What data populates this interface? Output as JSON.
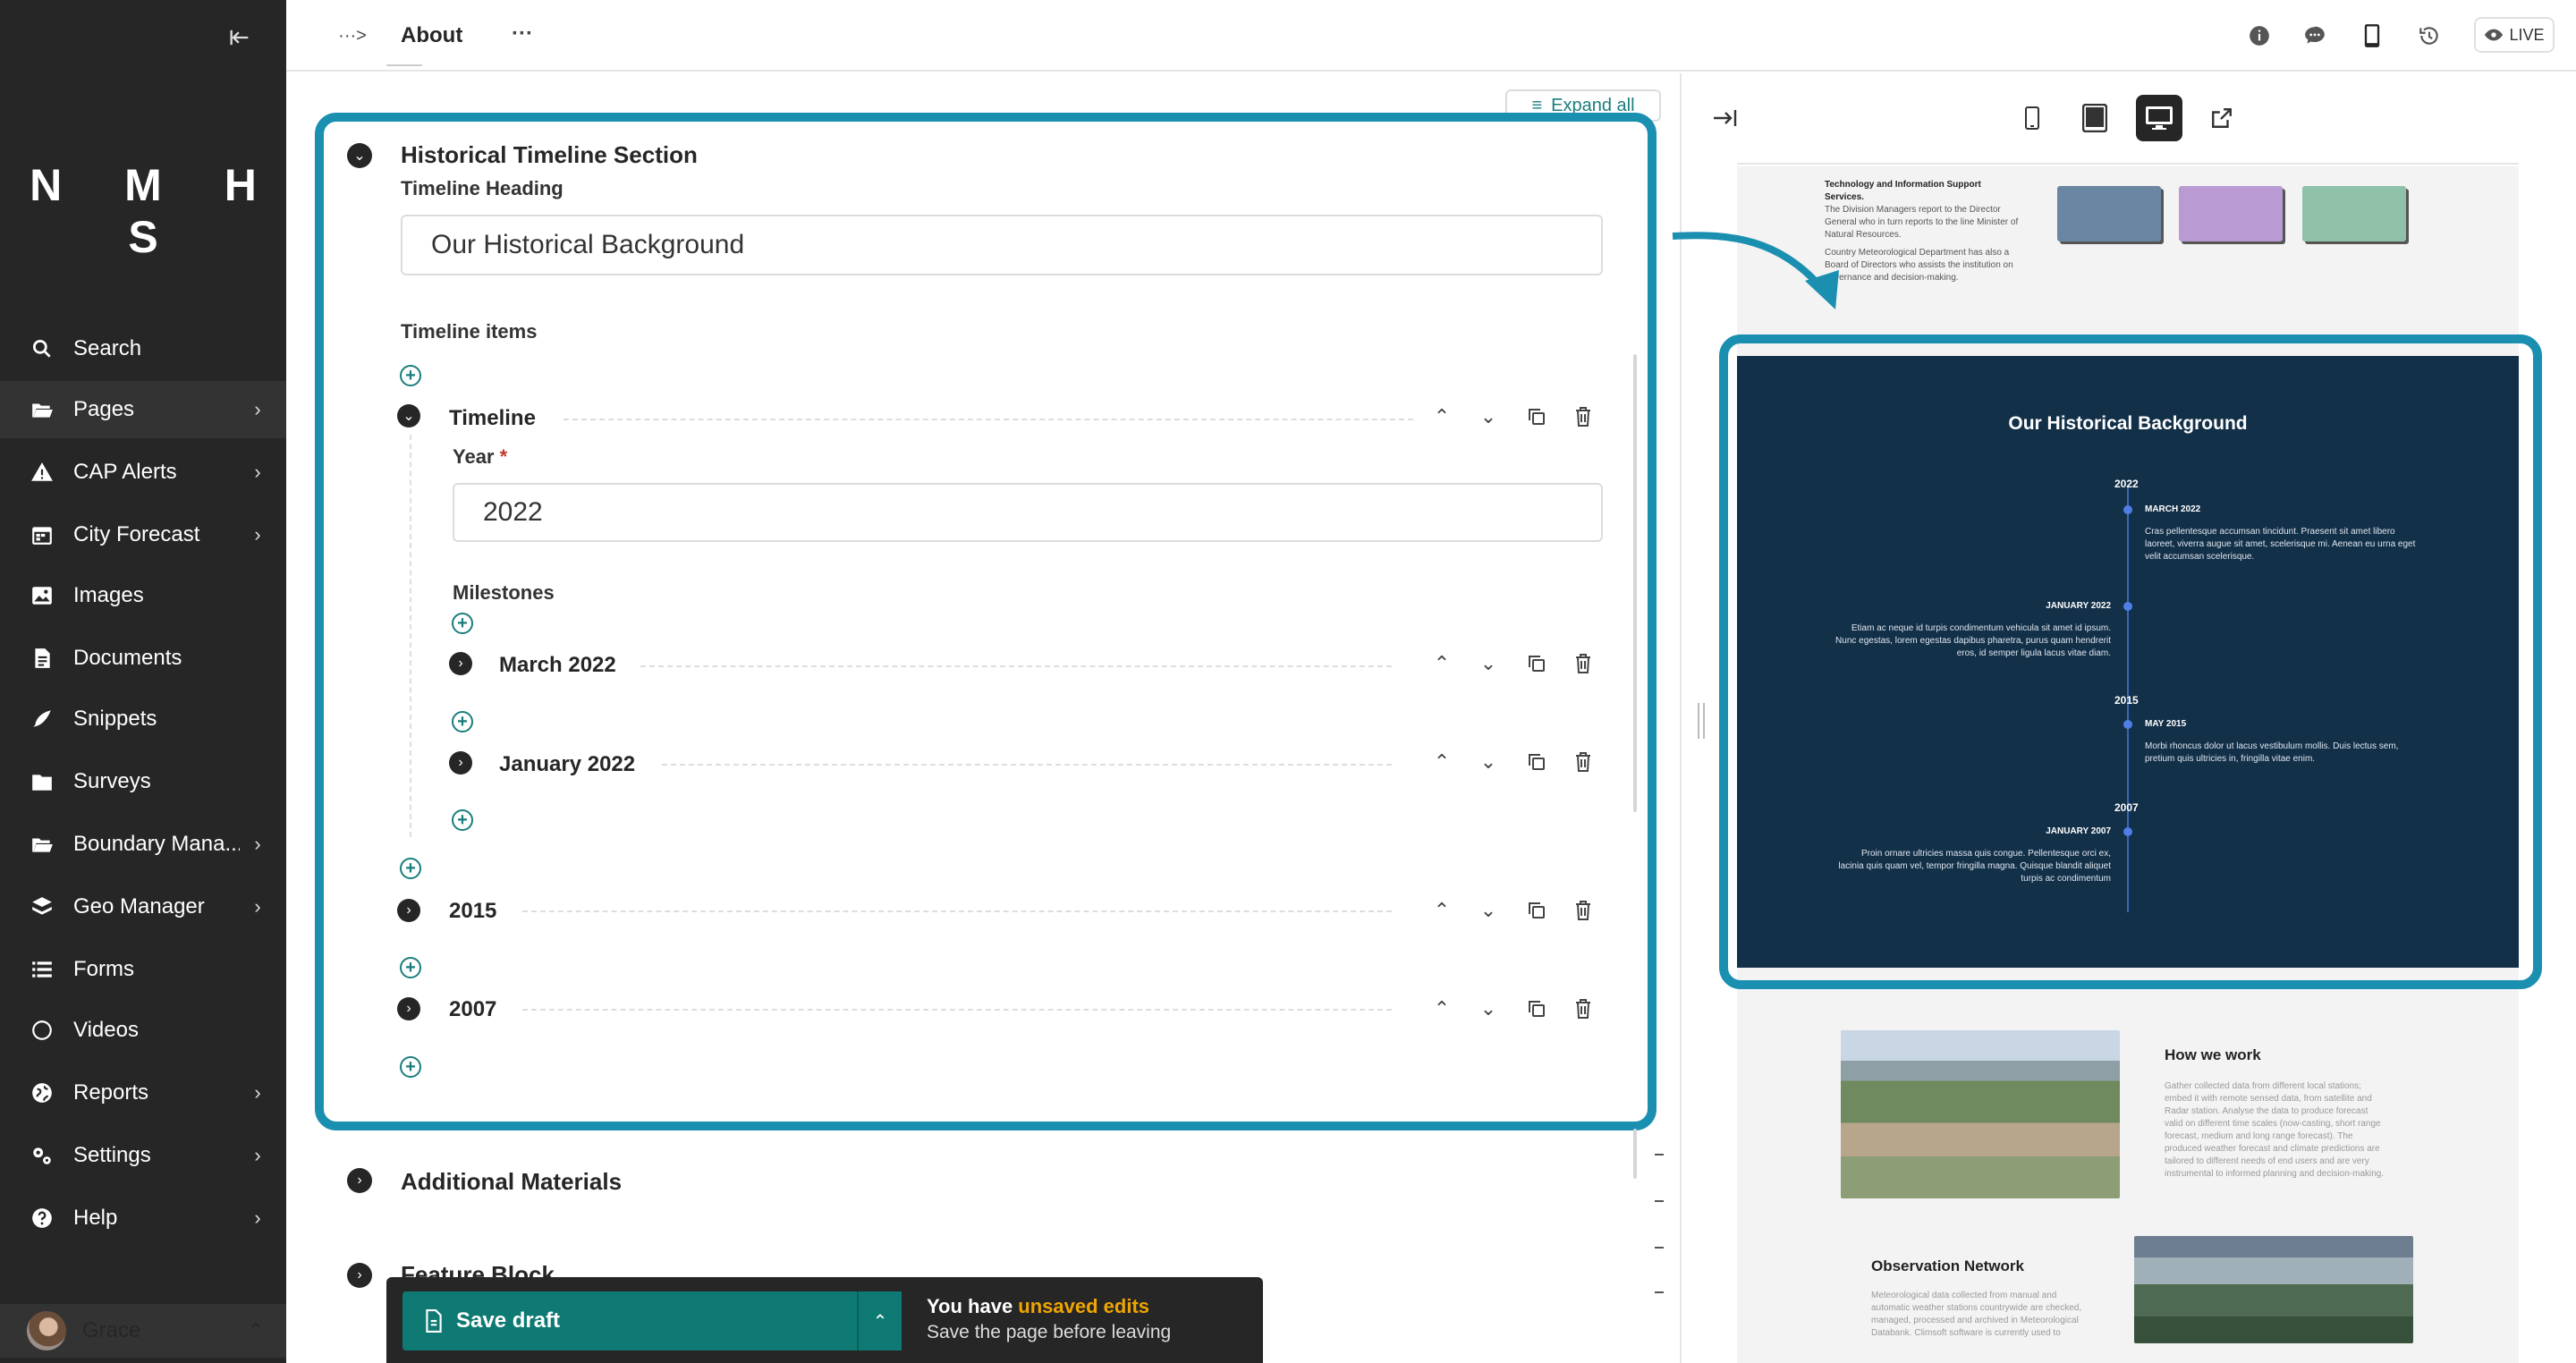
{
  "sidebar": {
    "logo": "N M H S",
    "items": [
      {
        "label": "Search",
        "chevron": false
      },
      {
        "label": "Pages",
        "chevron": true
      },
      {
        "label": "CAP Alerts",
        "chevron": true
      },
      {
        "label": "City Forecast",
        "chevron": true
      },
      {
        "label": "Images",
        "chevron": false
      },
      {
        "label": "Documents",
        "chevron": false
      },
      {
        "label": "Snippets",
        "chevron": false
      },
      {
        "label": "Surveys",
        "chevron": false
      },
      {
        "label": "Boundary Mana...",
        "chevron": true
      },
      {
        "label": "Geo Manager",
        "chevron": true
      },
      {
        "label": "Forms",
        "chevron": false
      },
      {
        "label": "Videos",
        "chevron": false
      },
      {
        "label": "Reports",
        "chevron": true
      },
      {
        "label": "Settings",
        "chevron": true
      },
      {
        "label": "Help",
        "chevron": true
      }
    ],
    "user": "Grace"
  },
  "header": {
    "breadcrumb_sep": "···>",
    "title": "About",
    "more": "···",
    "live": "LIVE"
  },
  "editor": {
    "expand_all": "Expand all",
    "section_title": "Historical Timeline Section",
    "timeline_heading_label": "Timeline Heading",
    "timeline_heading_value": "Our Historical Background",
    "timeline_items_label": "Timeline items",
    "timeline_block_label": "Timeline",
    "year_label": "Year",
    "year_required": "*",
    "year_value": "2022",
    "milestones_label": "Milestones",
    "milestones": [
      "March 2022",
      "January 2022"
    ],
    "other_timelines": [
      "2015",
      "2007"
    ],
    "additional_materials": "Additional Materials",
    "feature_block": "Feature Block"
  },
  "footer": {
    "save_draft": "Save draft",
    "notice_prefix": "You have ",
    "notice_highlight": "unsaved edits",
    "notice_sub": "Save the page before leaving"
  },
  "preview": {
    "top_heading": "Technology and Information Support Services.",
    "top_text_1": "The Division Managers report to the Director General who in turn reports to the line Minister of Natural Resources.",
    "top_text_2": "Country Meteorological Department has also a Board of Directors who assists the institution on governance and decision-making.",
    "timeline_title": "Our Historical Background",
    "entries": [
      {
        "year": "2022",
        "date": "MARCH 2022",
        "text": "Cras pellentesque accumsan tincidunt. Praesent sit amet libero laoreet, viverra augue sit amet, scelerisque mi. Aenean eu urna eget velit accumsan scelerisque."
      },
      {
        "year": "",
        "date": "JANUARY 2022",
        "text": "Etiam ac neque id turpis condimentum vehicula sit amet id ipsum. Nunc egestas, lorem egestas dapibus pharetra, purus quam hendrerit eros, id semper ligula lacus vitae diam."
      },
      {
        "year": "2015",
        "date": "MAY 2015",
        "text": "Morbi rhoncus dolor ut lacus vestibulum mollis. Duis lectus sem, pretium quis ultricies in, fringilla vitae enim."
      },
      {
        "year": "2007",
        "date": "JANUARY 2007",
        "text": "Proin ornare ultricies massa quis congue. Pellentesque orci ex, lacinia quis quam vel, tempor fringilla magna. Quisque blandit aliquet turpis ac condimentum"
      }
    ],
    "how_we_work_title": "How we work",
    "how_we_work_text": "Gather collected data from different local stations; embed it with remote sensed data, from satellite and Radar station. Analyse the data to produce forecast valid on different time scales (now-casting, short range forecast, medium and long range forecast). The produced weather forecast and climate predictions are tailored to different needs of end users and are very instrumental to informed planning and decision-making.",
    "obs_title": "Observation Network",
    "obs_text": "Meteorological data collected from manual and automatic weather stations countrywide are checked, managed, processed and archived in Meteorological Databank. Climsoft software is currently used to"
  },
  "colors": {
    "accent": "#1a8fb0",
    "save_green": "#0e7a73",
    "sidebar_bg": "#262626",
    "timeline_bg": "#133049",
    "unsaved": "#f0a500"
  }
}
